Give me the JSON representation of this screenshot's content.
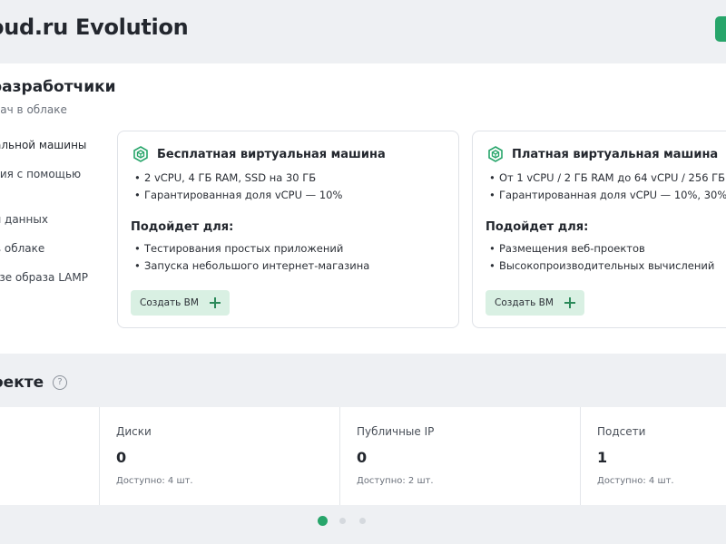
{
  "header": {
    "title": "oud.ru Evolution"
  },
  "developers": {
    "title": "разработчики",
    "subtitle": "дач в облаке",
    "side_items": [
      {
        "label": "альной машины",
        "active": true
      },
      {
        "label": "ния с помощью",
        "active": false
      },
      {
        "label": "я данных",
        "active": false
      },
      {
        "label": "в облаке",
        "active": false
      },
      {
        "label": "азе образа LAMP",
        "active": false
      }
    ],
    "cards": [
      {
        "title": "Бесплатная виртуальная машина",
        "specs": [
          "2 vCPU, 4 ГБ RAM, SSD на 30 ГБ",
          "Гарантированная доля vCPU — 10%"
        ],
        "suitable_title": "Подойдет для:",
        "suitable": [
          "Тестирования простых приложений",
          "Запуска небольшого интернет-магазина"
        ],
        "button_label": "Создать ВМ"
      },
      {
        "title": "Платная виртуальная машина",
        "specs": [
          "От 1 vCPU / 2 ГБ RAM до 64 vCPU / 256 ГБ",
          "Гарантированная доля vCPU — 10%, 30%"
        ],
        "suitable_title": "Подойдет для:",
        "suitable": [
          "Размещения веб-проектов",
          "Высокопроизводительных вычислений"
        ],
        "button_label": "Создать ВМ"
      }
    ]
  },
  "project": {
    "title": "оекте",
    "help_icon": "?",
    "stats": [
      {
        "label": "Диски",
        "value": "0",
        "available": "Доступно: 4 шт."
      },
      {
        "label": "Публичные IP",
        "value": "0",
        "available": "Доступно: 2 шт."
      },
      {
        "label": "Подсети",
        "value": "1",
        "available": "Доступно: 4 шт."
      }
    ]
  },
  "pagination": {
    "total": 3,
    "active_index": 0
  },
  "colors": {
    "accent": "#27a56a",
    "button_bg": "#d9f0e3",
    "page_bg": "#eef0f3"
  },
  "icons": {
    "card": "hexagon-cube-icon",
    "help": "question-circle-icon",
    "add": "plus-icon"
  }
}
